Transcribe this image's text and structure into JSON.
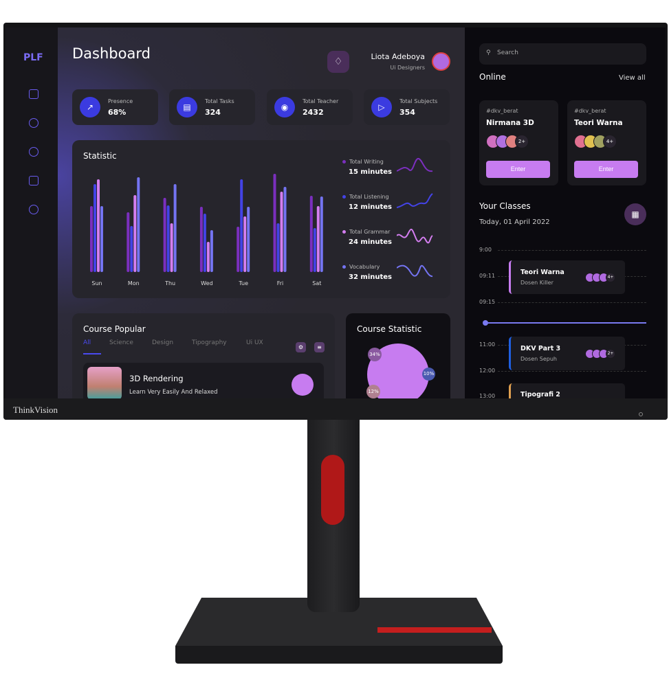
{
  "brand": "ThinkVision",
  "sidebar": {
    "logo": "PLF",
    "icons": [
      "grid-icon",
      "pie-chart-icon",
      "chat-icon",
      "wallet-icon",
      "settings-icon"
    ]
  },
  "header": {
    "title": "Dashboard",
    "user_name": "Liota Adeboya",
    "user_role": "Ui Designers"
  },
  "stats": [
    {
      "label": "Presence",
      "value": "68%",
      "icon": "trend-icon"
    },
    {
      "label": "Total Tasks",
      "value": "324",
      "icon": "document-icon"
    },
    {
      "label": "Total Teacher",
      "value": "2432",
      "icon": "graduation-cap-icon"
    },
    {
      "label": "Total Subjects",
      "value": "354",
      "icon": "megaphone-icon"
    }
  ],
  "chart_data": {
    "type": "bar",
    "title": "Statistic",
    "categories": [
      "Sun",
      "Mon",
      "Thu",
      "Wed",
      "Tue",
      "Fri",
      "Sat"
    ],
    "series": [
      {
        "name": "Total Writing",
        "color": "#7b2fbe",
        "values": [
          96,
          87,
          108,
          95,
          66,
          143,
          111
        ]
      },
      {
        "name": "Total Listening",
        "color": "#4343e6",
        "values": [
          128,
          67,
          97,
          85,
          135,
          71,
          64
        ]
      },
      {
        "name": "Total Grammar",
        "color": "#d47ef0",
        "values": [
          135,
          112,
          71,
          44,
          81,
          117,
          96
        ]
      },
      {
        "name": "Vocabulary",
        "color": "#7474f2",
        "values": [
          96,
          138,
          128,
          61,
          95,
          124,
          110
        ]
      }
    ]
  },
  "legend": [
    {
      "label": "Total Writing",
      "value": "15 minutes",
      "color": "#7b2fbe"
    },
    {
      "label": "Total Listening",
      "value": "12 minutes",
      "color": "#4343e6"
    },
    {
      "label": "Total Grammar",
      "value": "24 minutes",
      "color": "#d47ef0"
    },
    {
      "label": "Vocabulary",
      "value": "32 minutes",
      "color": "#7474f2"
    }
  ],
  "course_popular": {
    "title": "Course Popular",
    "tabs": [
      "All",
      "Science",
      "Design",
      "Tipography",
      "Ui UX"
    ],
    "item": {
      "title": "3D Rendering",
      "subtitle": "Learn Very Easily And Relaxed"
    }
  },
  "course_statistic": {
    "title": "Course Statistic",
    "bubbles": [
      "34%",
      "10%",
      "12%"
    ]
  },
  "right": {
    "search_placeholder": "Search",
    "online_title": "Online",
    "view_all": "View all",
    "online": [
      {
        "tag": "#dkv_berat",
        "name": "Nirmana 3D",
        "more": "2+",
        "enter": "Enter"
      },
      {
        "tag": "#dkv_berat",
        "name": "Teori Warna",
        "more": "4+",
        "enter": "Enter"
      }
    ],
    "classes_title": "Your Classes",
    "date": "Today, 01 April 2022",
    "times": [
      "9:00",
      "09:11",
      "09:15",
      "11:00",
      "12:00",
      "13:00"
    ],
    "classes": [
      {
        "name": "Teori Warna",
        "teacher": "Dosen Killer",
        "more": "4+",
        "color": "#c77cf0"
      },
      {
        "name": "DKV Part 3",
        "teacher": "Dosen Sepuh",
        "more": "2+",
        "color": "#1f5fe0"
      },
      {
        "name": "Tipografi 2",
        "teacher": "",
        "more": "",
        "color": "#e0a050"
      }
    ]
  }
}
